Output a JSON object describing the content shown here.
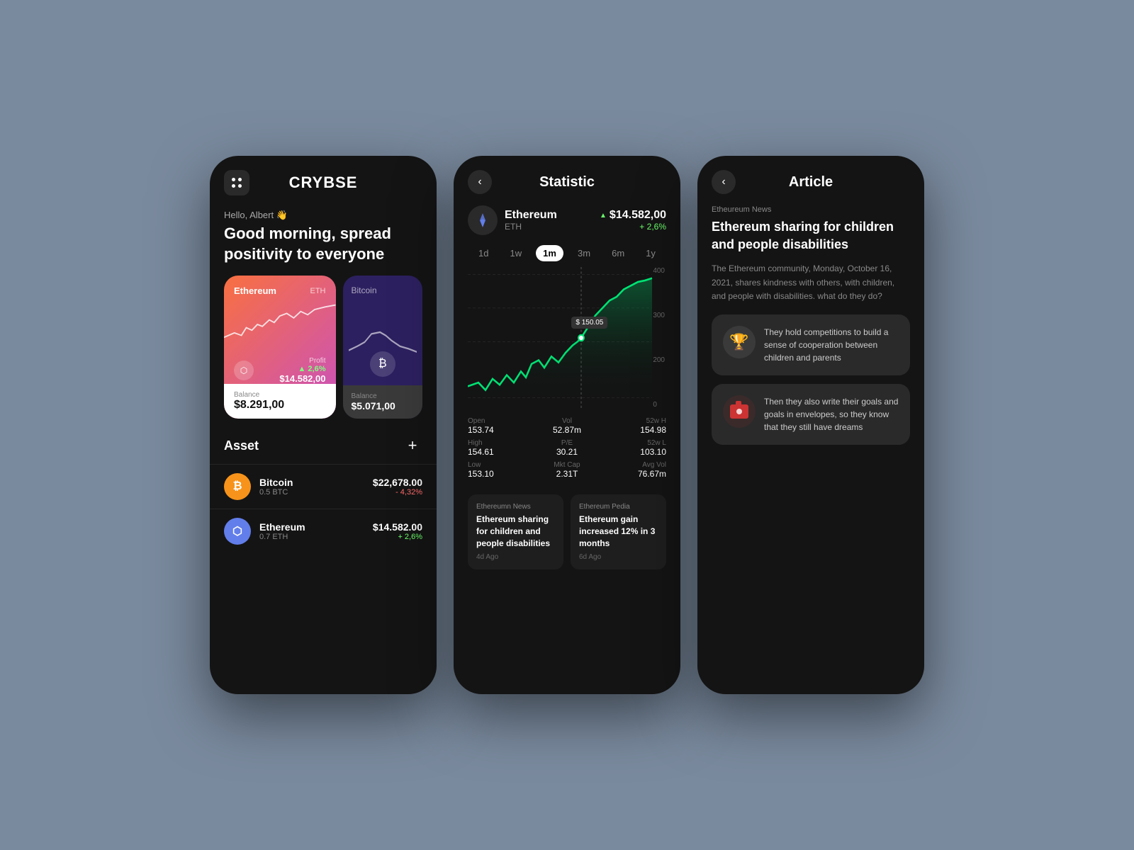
{
  "bg_color": "#7a8a9e",
  "phone1": {
    "logo": "CRYBSE",
    "greeting": "Hello, Albert 👋",
    "morning": "Good morning, spread positivity to everyone",
    "eth_card": {
      "label": "Ethereum",
      "tag": "ETH",
      "profit_label": "Profit",
      "profit_change": "▲ 2,6%",
      "profit_price": "$14.582,00",
      "balance_label": "Balance",
      "balance_val": "$8.291,00"
    },
    "btc_card": {
      "label": "Bitcoin",
      "balance_label": "Balance",
      "balance_val": "$5.071,00"
    },
    "asset_title": "Asset",
    "asset_plus": "+",
    "assets": [
      {
        "name": "Bitcoin",
        "sub": "0.5 BTC",
        "price": "$22,678.00",
        "change": "- 4,32%",
        "change_type": "neg",
        "icon": "₿"
      },
      {
        "name": "Ethereum",
        "sub": "0.7 ETH",
        "price": "$14.582.00",
        "change": "+ 2,6%",
        "change_type": "pos",
        "icon": "⬡"
      }
    ]
  },
  "phone2": {
    "title": "Statistic",
    "back": "<",
    "coin": {
      "name": "Ethereum",
      "symbol": "ETH",
      "price": "$14.582,00",
      "change": "+ 2,6%"
    },
    "time_tabs": [
      "1d",
      "1w",
      "1m",
      "3m",
      "6m",
      "1y"
    ],
    "active_tab": "1m",
    "chart_tooltip": "$ 150.05",
    "y_labels": [
      "400",
      "300",
      "200",
      "0"
    ],
    "stats": [
      {
        "label": "Open",
        "val": "153.74",
        "label2": "Vol",
        "val2": "52.87m"
      },
      {
        "label": "High",
        "val": "154.61",
        "label2": "P/E",
        "val2": "30.21"
      },
      {
        "label": "Low",
        "val": "153.10",
        "label2": "Mkt Cap",
        "val2": "2.31T"
      },
      {
        "label": "52w H",
        "val": "154.98"
      },
      {
        "label": "52w L",
        "val": "103.10"
      },
      {
        "label": "Avg Vol",
        "val": "76.67m"
      }
    ],
    "news": [
      {
        "source": "Ethereumn News",
        "headline": "Ethereum sharing for children and people disabilities",
        "time": "4d Ago"
      },
      {
        "source": "Ethereum Pedia",
        "headline": "Ethereum gain increased 12% in 3 months",
        "time": "6d Ago"
      }
    ]
  },
  "phone3": {
    "title": "Article",
    "back": "<",
    "source": "Etheureum News",
    "headline": "Ethereum sharing for children and people disabilities",
    "body": "The Ethereum community, Monday, October 16, 2021, shares kindness with others, with children, and people with disabilities. what do they do?",
    "cards": [
      {
        "icon": "🏆",
        "text": "They hold competitions to build a sense of cooperation between children and parents"
      },
      {
        "icon": "📷",
        "text": "Then they also write their goals and goals in envelopes, so they know that they still have dreams"
      }
    ]
  }
}
